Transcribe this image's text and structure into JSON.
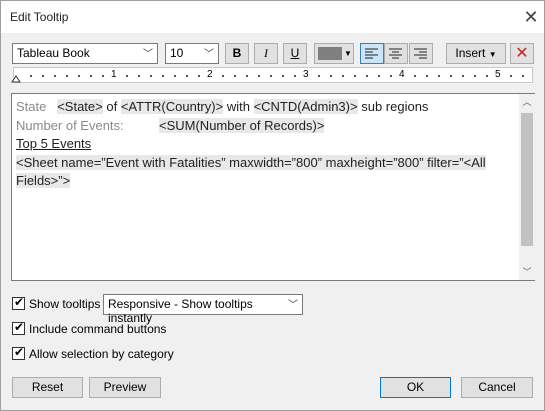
{
  "window": {
    "title": "Edit Tooltip"
  },
  "toolbar": {
    "font_name": "Tableau Book",
    "font_size": "10",
    "bold": "B",
    "italic": "I",
    "underline": "U",
    "font_color": "#7f7f7f",
    "insert_label": "Insert",
    "active_alignment": "left"
  },
  "ruler": {
    "marks": [
      "1",
      "2",
      "3",
      "4",
      "5"
    ]
  },
  "editor": {
    "line1": {
      "label": "State",
      "field1": "<State>",
      "text1": "of",
      "field2": "<ATTR(Country)>",
      "text2": "with",
      "field3": "<CNTD(Admin3)>",
      "text3": "sub regions"
    },
    "line2": {
      "label": "Number of Events:",
      "field": "<SUM(Number of Records)>"
    },
    "line3": {
      "heading": "Top 5 Events"
    },
    "line4": {
      "sheet_tag": "<Sheet name=”Event with Fatalities” maxwidth=”800” maxheight=”800” filter=”<All Fields>”>"
    }
  },
  "options": {
    "show_tooltips": {
      "label": "Show tooltips",
      "checked": true
    },
    "tooltip_mode": "Responsive - Show tooltips instantly",
    "include_command_buttons": {
      "label": "Include command buttons",
      "checked": true
    },
    "allow_selection": {
      "label": "Allow selection by category",
      "checked": true
    }
  },
  "buttons": {
    "reset": "Reset",
    "preview": "Preview",
    "ok": "OK",
    "cancel": "Cancel"
  }
}
